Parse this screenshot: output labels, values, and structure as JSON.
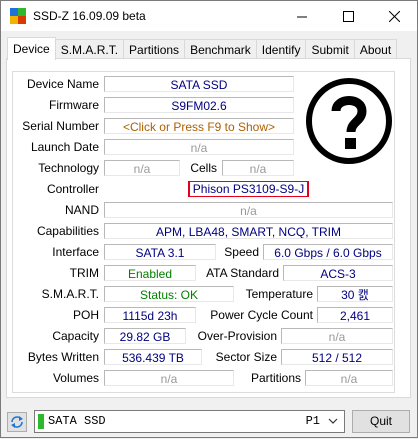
{
  "window": {
    "title": "SSD-Z 16.09.09 beta",
    "minimize": "—",
    "maximize": "☐",
    "close": "✕"
  },
  "tabs": [
    "Device",
    "S.M.A.R.T.",
    "Partitions",
    "Benchmark",
    "Identify",
    "Submit",
    "About"
  ],
  "device": {
    "device_name": {
      "label": "Device Name",
      "value": "SATA SSD"
    },
    "firmware": {
      "label": "Firmware",
      "value": "S9FM02.6"
    },
    "serial": {
      "label": "Serial Number",
      "value": "<Click or Press F9 to Show>"
    },
    "launch_date": {
      "label": "Launch Date",
      "value": "n/a"
    },
    "technology": {
      "label": "Technology",
      "value": "n/a"
    },
    "cells": {
      "label": "Cells",
      "value": "n/a"
    },
    "controller": {
      "label": "Controller",
      "value": "Phison PS3109-S9-J"
    },
    "nand": {
      "label": "NAND",
      "value": "n/a"
    },
    "capabilities": {
      "label": "Capabilities",
      "value": "APM, LBA48, SMART, NCQ, TRIM"
    },
    "interface": {
      "label": "Interface",
      "value": "SATA 3.1"
    },
    "speed": {
      "label": "Speed",
      "value": "6.0 Gbps / 6.0 Gbps"
    },
    "trim": {
      "label": "TRIM",
      "value": "Enabled"
    },
    "ata_standard": {
      "label": "ATA Standard",
      "value": "ACS-3"
    },
    "smart": {
      "label": "S.M.A.R.T.",
      "value": "Status: OK"
    },
    "temperature": {
      "label": "Temperature",
      "value": "30 캜"
    },
    "poh": {
      "label": "POH",
      "value": "1115d 23h"
    },
    "power_cycle": {
      "label": "Power Cycle Count",
      "value": "2,461"
    },
    "capacity": {
      "label": "Capacity",
      "value": "29.82 GB"
    },
    "over_provision": {
      "label": "Over-Provision",
      "value": "n/a"
    },
    "bytes_written": {
      "label": "Bytes Written",
      "value": "536.439 TB"
    },
    "sector_size": {
      "label": "Sector Size",
      "value": "512 / 512"
    },
    "volumes": {
      "label": "Volumes",
      "value": "n/a"
    },
    "partitions": {
      "label": "Partitions",
      "value": "n/a"
    }
  },
  "bottom": {
    "drive": "SATA SSD",
    "port": "P1",
    "quit": "Quit"
  },
  "colors": {
    "value_blue": "#000080",
    "ok_green": "#008000",
    "highlight_red": "#e2001a",
    "drive_stripe": "#2eb82e"
  }
}
